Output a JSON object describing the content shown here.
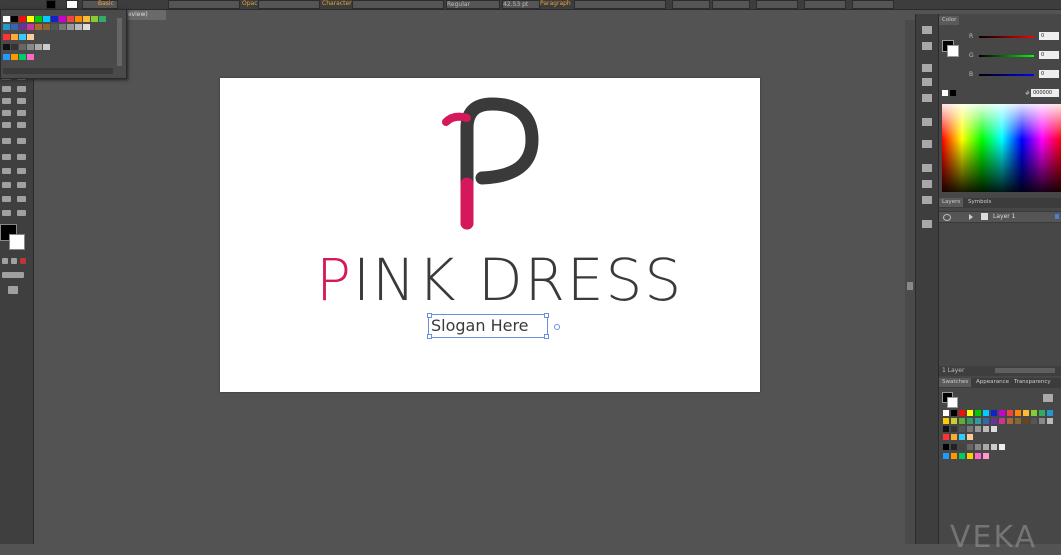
{
  "document": {
    "tab_label": "Preview)",
    "logo_initial": "P",
    "brand_name_first": "P",
    "brand_name_rest": "ink Dress",
    "slogan": "Slogan Here"
  },
  "topbar": {
    "fields": [
      "Basic",
      "Opacity",
      "Character",
      "Regular",
      "42.53 pt",
      "Paragraph"
    ]
  },
  "panels": {
    "color_tab": "Color",
    "rgb_labels": [
      "R",
      "G",
      "B"
    ],
    "rgb_values": [
      "0",
      "0",
      "0"
    ],
    "hex_symbol": "#",
    "hex_value": "000000",
    "layers_tab": "Layers",
    "symbols_tab": "Symbols",
    "layer_name": "Layer 1",
    "layer_count": "1 Layer",
    "swatches_tab": "Swatches",
    "appearance_tab": "Appearance",
    "transparency_tab": "Transparency"
  },
  "watermark": "VEKA",
  "colors": {
    "accent_pink": "#d4185b",
    "logo_dark": "#3a3a3a",
    "canvas_bg": "#535353",
    "artboard": "#ffffff"
  },
  "icons": [
    "selection-tool-icon",
    "pen-tool-icon",
    "type-tool-icon",
    "brush-tool-icon",
    "hand-tool-icon",
    "zoom-tool-icon",
    "eye-icon",
    "color-guide-icon"
  ]
}
